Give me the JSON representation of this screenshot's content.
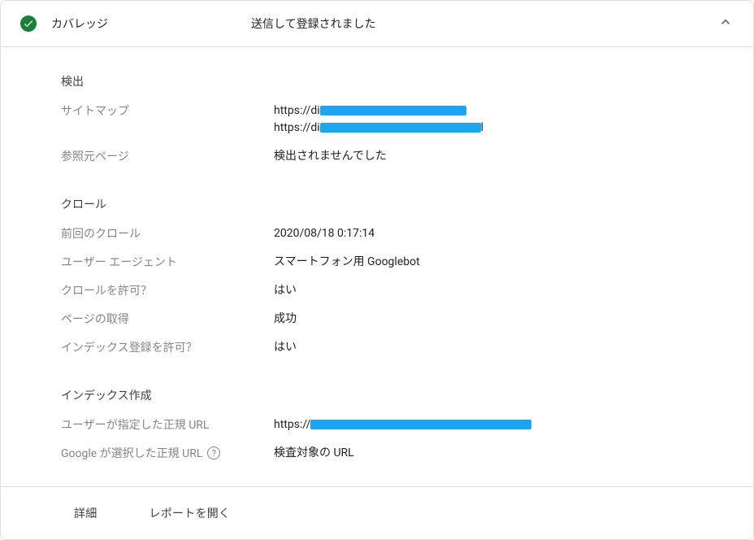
{
  "header": {
    "title": "カバレッジ",
    "status": "送信して登録されました"
  },
  "sections": {
    "discovery": {
      "title": "検出",
      "sitemaps_label": "サイトマップ",
      "sitemap1_prefix": "https://di",
      "sitemap2_prefix": "https://di",
      "sitemap2_suffix": "l",
      "referring_label": "参照元ページ",
      "referring_value": "検出されませんでした"
    },
    "crawl": {
      "title": "クロール",
      "last_crawl_label": "前回のクロール",
      "last_crawl_value": "2020/08/18 0:17:14",
      "user_agent_label": "ユーザー エージェント",
      "user_agent_value": "スマートフォン用 Googlebot",
      "crawl_allowed_label": "クロールを許可？",
      "crawl_allowed_value": "はい",
      "page_fetch_label": "ページの取得",
      "page_fetch_value": "成功",
      "indexing_allowed_label": "インデックス登録を許可？",
      "indexing_allowed_value": "はい"
    },
    "indexing": {
      "title": "インデックス作成",
      "user_canonical_label": "ユーザーが指定した正規 URL",
      "user_canonical_prefix": "https://",
      "google_canonical_label": "Google が選択した正規 URL",
      "google_canonical_value": "検査対象の URL"
    }
  },
  "footer": {
    "details": "詳細",
    "open_report": "レポートを開く"
  }
}
